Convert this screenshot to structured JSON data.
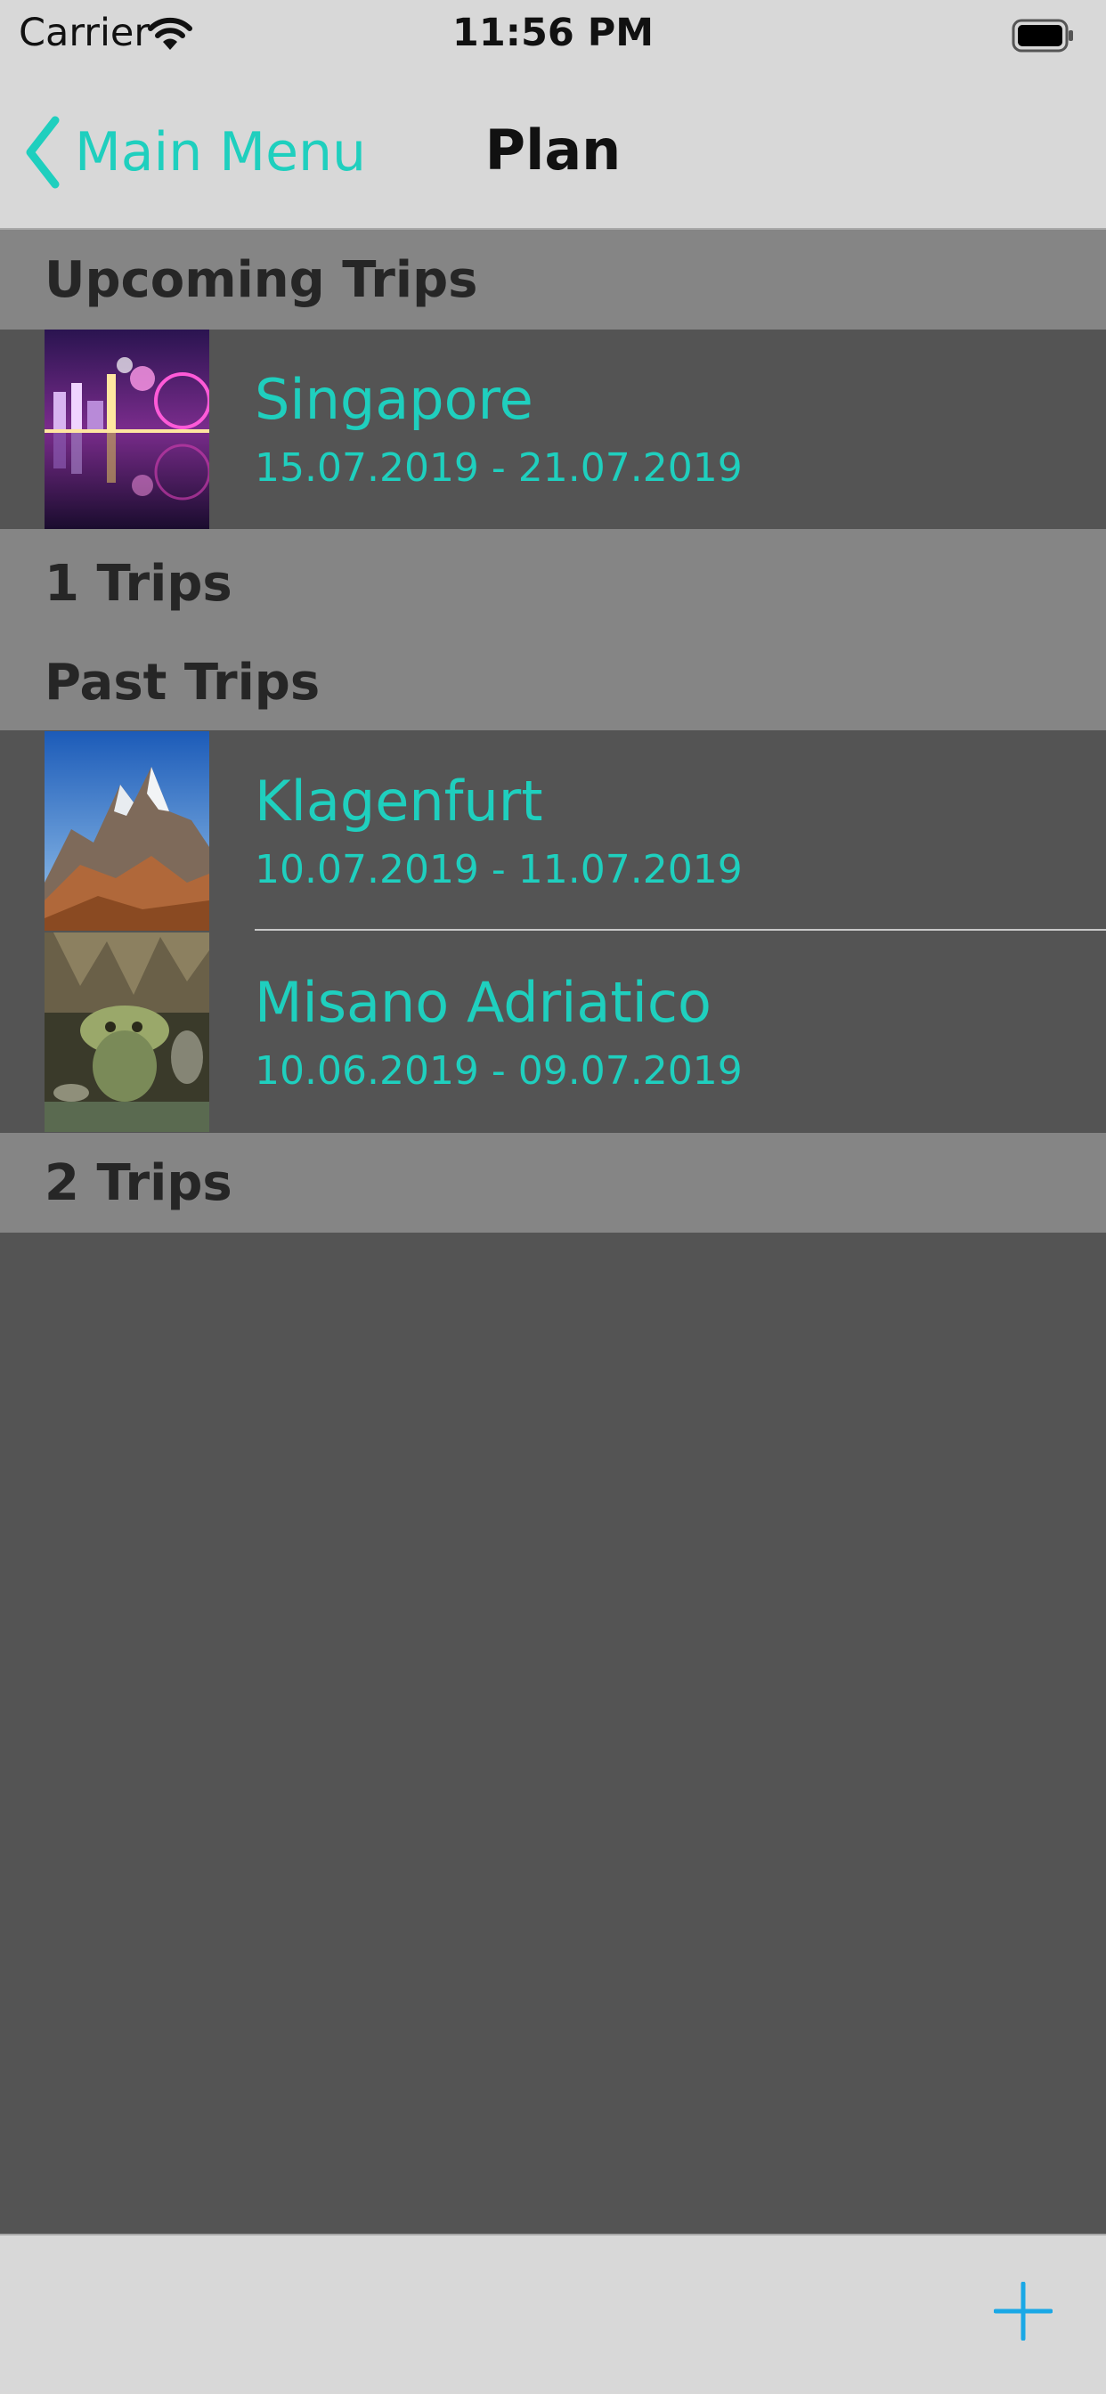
{
  "status_bar": {
    "carrier": "Carrier",
    "time": "11:56 PM"
  },
  "nav": {
    "back_label": "Main Menu",
    "title": "Plan"
  },
  "sections": {
    "upcoming": {
      "title": "Upcoming Trips",
      "footer": "1 Trips",
      "trips": [
        {
          "name": "Singapore",
          "dates": "15.07.2019 - 21.07.2019"
        }
      ]
    },
    "past": {
      "title": "Past Trips",
      "footer": "2 Trips",
      "trips": [
        {
          "name": "Klagenfurt",
          "dates": "10.07.2019 - 11.07.2019"
        },
        {
          "name": "Misano Adriatico",
          "dates": "10.06.2019 - 09.07.2019"
        }
      ]
    }
  },
  "colors": {
    "accent": "#1fcfbe",
    "background": "#545454",
    "section_header": "#858585",
    "bars": "#d8d8d8",
    "add_button": "#1aa8e6"
  },
  "icons": {
    "status_wifi": "wifi-icon",
    "status_battery": "battery-icon",
    "back": "chevron-left-icon",
    "add": "plus-icon"
  }
}
